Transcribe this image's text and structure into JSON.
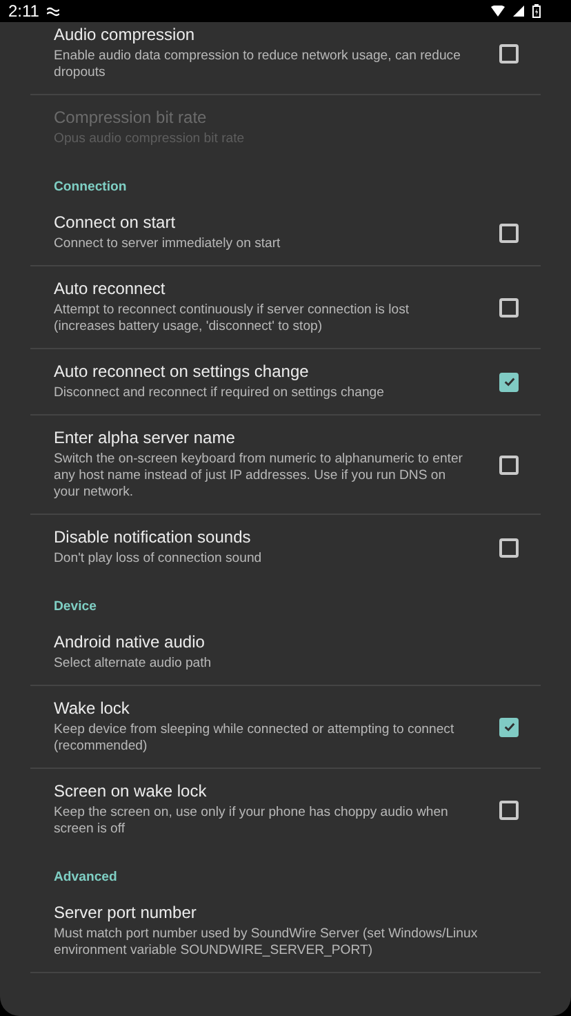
{
  "status_bar": {
    "time": "2:11"
  },
  "items": [
    {
      "kind": "setting",
      "title": "Audio compression",
      "summary": "Enable audio data compression to reduce network usage, can reduce dropouts",
      "checked": false,
      "disabled": false
    },
    {
      "kind": "setting",
      "title": "Compression bit rate",
      "summary": "Opus audio compression bit rate",
      "disabled": true
    },
    {
      "kind": "section",
      "title": "Connection"
    },
    {
      "kind": "setting",
      "title": "Connect on start",
      "summary": "Connect to server immediately on start",
      "checked": false,
      "disabled": false
    },
    {
      "kind": "setting",
      "title": "Auto reconnect",
      "summary": "Attempt to reconnect continuously if server connection is lost (increases battery usage, 'disconnect' to stop)",
      "checked": false,
      "disabled": false
    },
    {
      "kind": "setting",
      "title": "Auto reconnect on settings change",
      "summary": "Disconnect and reconnect if required on settings change",
      "checked": true,
      "disabled": false
    },
    {
      "kind": "setting",
      "title": "Enter alpha server name",
      "summary": "Switch the on-screen keyboard from numeric to alphanumeric to enter any host name instead of just IP addresses. Use if you run DNS on your network.",
      "checked": false,
      "disabled": false
    },
    {
      "kind": "setting",
      "title": "Disable notification sounds",
      "summary": "Don't play loss of connection sound",
      "checked": false,
      "disabled": false
    },
    {
      "kind": "section",
      "title": "Device"
    },
    {
      "kind": "setting",
      "title": "Android native audio",
      "summary": "Select alternate audio path",
      "disabled": false
    },
    {
      "kind": "setting",
      "title": "Wake lock",
      "summary": "Keep device from sleeping while connected or attempting to connect (recommended)",
      "checked": true,
      "disabled": false
    },
    {
      "kind": "setting",
      "title": "Screen on wake lock",
      "summary": "Keep the screen on, use only if your phone has choppy audio when screen is off",
      "checked": false,
      "disabled": false
    },
    {
      "kind": "section",
      "title": "Advanced"
    },
    {
      "kind": "setting",
      "title": "Server port number",
      "summary": "Must match port number used by SoundWire Server (set Windows/Linux environment variable SOUNDWIRE_SERVER_PORT)",
      "disabled": false
    }
  ]
}
